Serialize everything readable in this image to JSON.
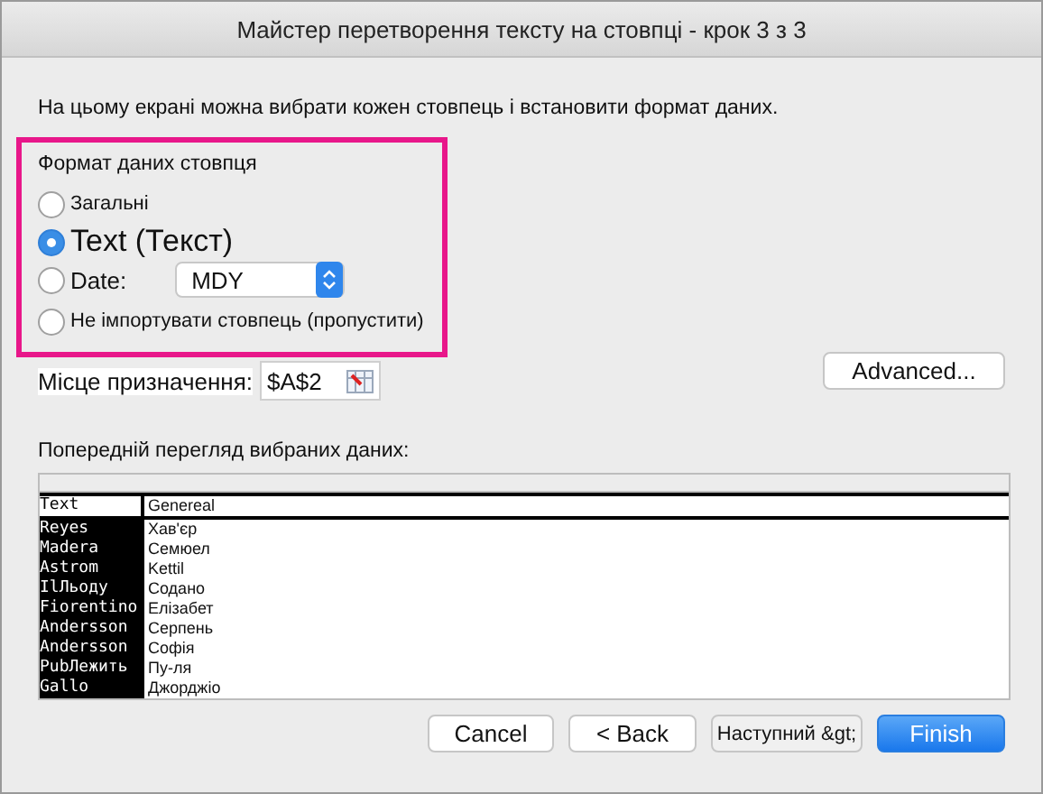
{
  "window": {
    "title": "Майстер перетворення тексту на стовпці - крок 3 з 3"
  },
  "instruction": "На цьому екрані можна вибрати кожен стовпець і встановити формат даних.",
  "format_group": {
    "title": "Формат даних стовпця",
    "options": [
      {
        "kind": "plain",
        "label": "Загальні",
        "selected": false
      },
      {
        "kind": "large",
        "label": "Text (Текст)",
        "selected": true
      },
      {
        "kind": "select",
        "label": "Date:",
        "selected": false,
        "value": "MDY"
      },
      {
        "kind": "plain",
        "label": "Не імпортувати стовпець (пропустити)",
        "selected": false
      }
    ]
  },
  "destination": {
    "label": "Місце призначення:",
    "value": "$A$2"
  },
  "advanced_button": "Advanced...",
  "preview": {
    "label": "Попередній перегляд вибраних даних:",
    "header": [
      "Text",
      "Genereal"
    ],
    "rows": [
      [
        "Reyes",
        "Хав'єр"
      ],
      [
        "Madera",
        "Семюел"
      ],
      [
        "Astrom",
        "Kettil"
      ],
      [
        "IlЛьоду",
        "Содано"
      ],
      [
        "Fiorentino",
        "Елізабет"
      ],
      [
        "Andersson",
        "Серпень"
      ],
      [
        "Andersson",
        "Софія"
      ],
      [
        "PubЛежить",
        "Пу-ля"
      ],
      [
        "Gallo",
        "Джорджіо"
      ]
    ]
  },
  "buttons": [
    {
      "kind": "normal",
      "label": "Cancel"
    },
    {
      "kind": "normal",
      "label": "< Back"
    },
    {
      "kind": "disabled",
      "label": "Наступний &gt;"
    },
    {
      "kind": "default",
      "label": "Finish"
    }
  ]
}
